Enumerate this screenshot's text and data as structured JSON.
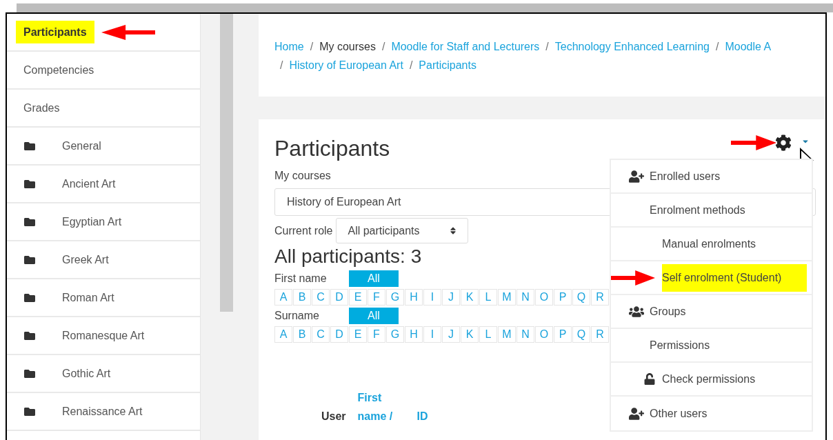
{
  "sidebar": {
    "items": [
      {
        "label": "Participants",
        "kind": "link",
        "highlighted": true
      },
      {
        "label": "Competencies",
        "kind": "link",
        "highlighted": false
      },
      {
        "label": "Grades",
        "kind": "link",
        "highlighted": false
      },
      {
        "label": "General",
        "kind": "section",
        "highlighted": false
      },
      {
        "label": "Ancient Art",
        "kind": "section",
        "highlighted": false
      },
      {
        "label": "Egyptian Art",
        "kind": "section",
        "highlighted": false
      },
      {
        "label": "Greek Art",
        "kind": "section",
        "highlighted": false
      },
      {
        "label": "Roman Art",
        "kind": "section",
        "highlighted": false
      },
      {
        "label": "Romanesque Art",
        "kind": "section",
        "highlighted": false
      },
      {
        "label": "Gothic Art",
        "kind": "section",
        "highlighted": false
      },
      {
        "label": "Renaissance Art",
        "kind": "section",
        "highlighted": false
      }
    ]
  },
  "breadcrumbs": [
    [
      {
        "label": "Home",
        "link": true
      },
      {
        "label": "My courses",
        "link": false
      },
      {
        "label": "Moodle for Staff and Lecturers",
        "link": true
      },
      {
        "label": "Technology Enhanced Learning",
        "link": true
      },
      {
        "label": "Moodle A",
        "link": true
      }
    ],
    [
      {
        "label": "History of European Art",
        "link": true
      },
      {
        "label": "Participants",
        "link": true
      }
    ]
  ],
  "separator": "/",
  "page": {
    "title": "Participants",
    "course_label": "My courses",
    "course_value": "History of European Art",
    "role_label": "Current role",
    "role_value": "All participants",
    "count_heading": "All participants: 3",
    "filters": [
      {
        "label": "First name",
        "all": "All",
        "letters": [
          "A",
          "B",
          "C",
          "D",
          "E",
          "F",
          "G",
          "H",
          "I",
          "J",
          "K",
          "L",
          "M",
          "N",
          "O",
          "P",
          "Q",
          "R"
        ]
      },
      {
        "label": "Surname",
        "all": "All",
        "letters": [
          "A",
          "B",
          "C",
          "D",
          "E",
          "F",
          "G",
          "H",
          "I",
          "J",
          "K",
          "L",
          "M",
          "N",
          "O",
          "P",
          "Q",
          "R"
        ]
      }
    ],
    "columns": [
      {
        "label": "User",
        "link": false
      },
      {
        "label": "First name /",
        "link": true
      },
      {
        "label": "ID",
        "link": true
      }
    ]
  },
  "settings_menu": {
    "arrow": true,
    "items": [
      {
        "label": "Enrolled users",
        "kind": "enrol",
        "highlighted": false
      },
      {
        "label": "Enrolment methods",
        "kind": "plain",
        "highlighted": false,
        "children": [
          {
            "label": "Manual enrolments",
            "kind": "plain",
            "highlighted": false
          },
          {
            "label": "Self enrolment (Student)",
            "kind": "plain",
            "highlighted": true
          }
        ]
      },
      {
        "label": "Groups",
        "kind": "group",
        "highlighted": false
      },
      {
        "label": "Permissions",
        "kind": "plain",
        "highlighted": false,
        "children": [
          {
            "label": "Check permissions",
            "kind": "lock",
            "highlighted": false
          }
        ]
      },
      {
        "label": "Other users",
        "kind": "enrol",
        "highlighted": false
      }
    ]
  }
}
